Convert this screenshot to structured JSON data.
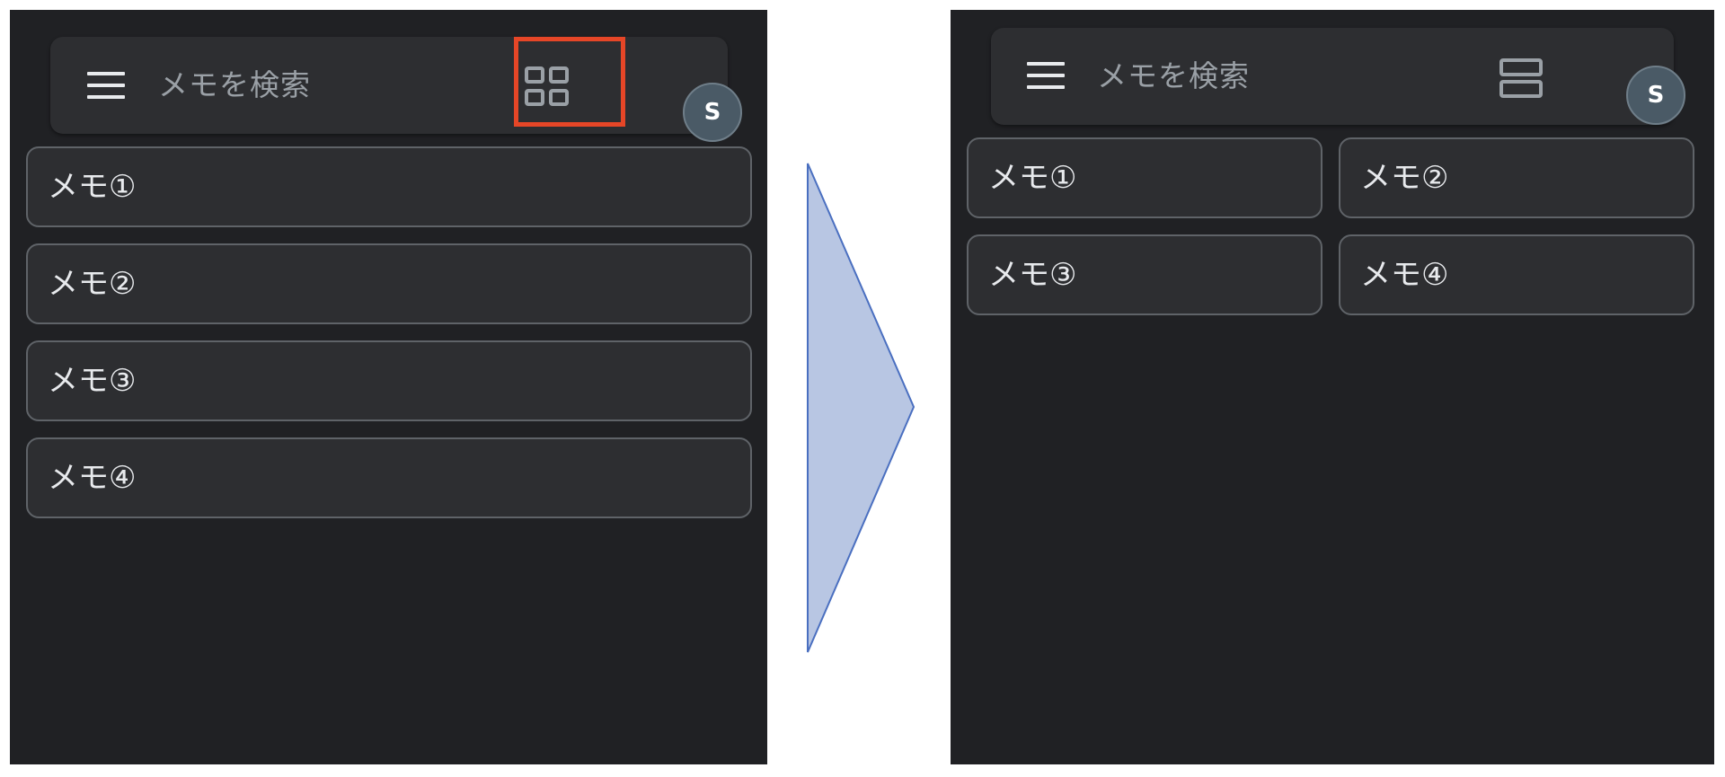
{
  "before": {
    "search_placeholder": "メモを検索",
    "avatar_initial": "S",
    "view_toggle_icon": "grid-view-icon",
    "notes": [
      "メモ①",
      "メモ②",
      "メモ③",
      "メモ④"
    ]
  },
  "after": {
    "search_placeholder": "メモを検索",
    "avatar_initial": "S",
    "view_toggle_icon": "list-view-icon",
    "notes": [
      "メモ①",
      "メモ②",
      "メモ③",
      "メモ④"
    ]
  },
  "colors": {
    "background": "#202124",
    "surface": "#2d2e31",
    "highlight": "#e64627",
    "arrow_fill": "#b8c6e3",
    "arrow_stroke": "#4a6fc0"
  }
}
